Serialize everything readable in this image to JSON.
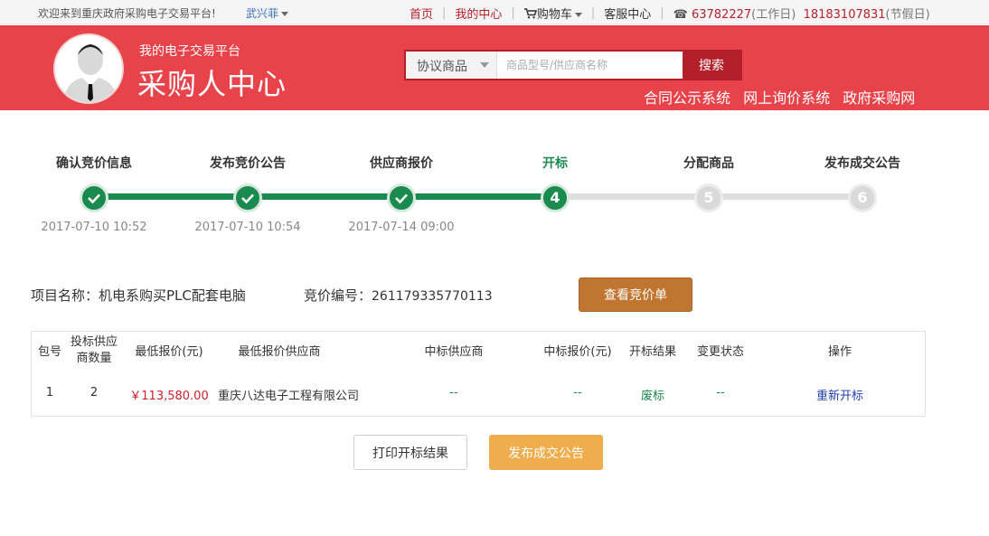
{
  "topbar": {
    "welcome": "欢迎来到重庆政府采购电子交易平台!",
    "user": "武兴菲",
    "nav": {
      "home": "首页",
      "my_center": "我的中心",
      "cart": "购物车",
      "service": "客服中心",
      "phone_workday": "63782227",
      "phone_workday_note": "(工作日)",
      "phone_holiday": "18183107831",
      "phone_holiday_note": "(节假日)"
    }
  },
  "header": {
    "subtitle": "我的电子交易平台",
    "title": "采购人中心",
    "search": {
      "category": "协议商品",
      "placeholder": "商品型号/供应商名称",
      "button": "搜索"
    },
    "links": [
      "合同公示系统",
      "网上询价系统",
      "政府采购网"
    ]
  },
  "steps": [
    {
      "label": "确认竞价信息",
      "state": "done",
      "time": "2017-07-10 10:52"
    },
    {
      "label": "发布竞价公告",
      "state": "done",
      "time": "2017-07-10 10:54"
    },
    {
      "label": "供应商报价",
      "state": "done",
      "time": "2017-07-14 09:00"
    },
    {
      "label": "开标",
      "state": "current",
      "num": "4",
      "time": ""
    },
    {
      "label": "分配商品",
      "state": "todo",
      "num": "5",
      "time": ""
    },
    {
      "label": "发布成交公告",
      "state": "todo",
      "num": "6",
      "time": ""
    }
  ],
  "project": {
    "name_label": "项目名称：",
    "name": "机电系购买PLC配套电脑",
    "code_label": "竞价编号：",
    "code": "261179335770113",
    "view_button": "查看竞价单"
  },
  "table": {
    "headers": {
      "pkg": "包号",
      "bidders_l1": "投标供应",
      "bidders_l2": "商数量",
      "min_price": "最低报价(元)",
      "min_supplier": "最低报价供应商",
      "win_supplier": "中标供应商",
      "win_price": "中标报价(元)",
      "result": "开标结果",
      "change": "变更状态",
      "action": "操作"
    },
    "row": {
      "pkg": "1",
      "bidders": "2",
      "min_price": "￥113,580.00",
      "min_supplier": "重庆八达电子工程有限公司",
      "win_supplier": "--",
      "win_price": "--",
      "result": "废标",
      "change": "--",
      "action": "重新开标"
    }
  },
  "footer": {
    "print": "打印开标结果",
    "publish": "发布成交公告"
  }
}
